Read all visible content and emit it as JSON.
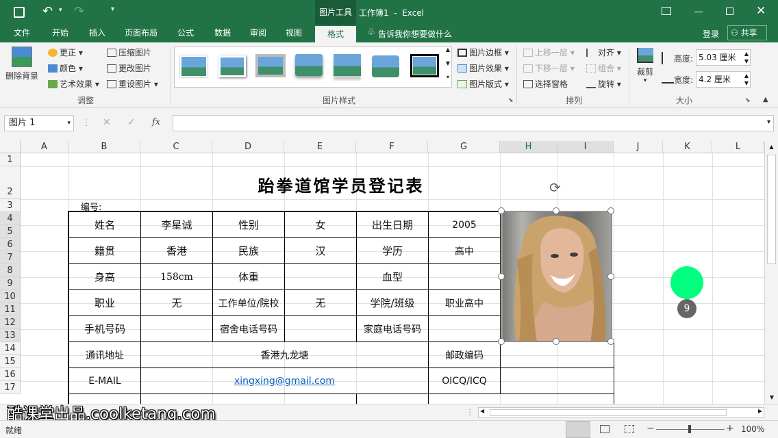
{
  "titlebar": {
    "tool_label": "图片工具",
    "doc_title": "工作簿1  -  Excel"
  },
  "tabs": [
    "文件",
    "开始",
    "插入",
    "页面布局",
    "公式",
    "数据",
    "审阅",
    "视图",
    "格式"
  ],
  "tell_me": "告诉我你想要做什么",
  "account": {
    "login": "登录",
    "share": "共享"
  },
  "ribbon": {
    "remove_bg": "删除背景",
    "adjust": [
      "更正",
      "颜色",
      "艺术效果"
    ],
    "adjust2": [
      "压缩图片",
      "更改图片",
      "重设图片"
    ],
    "adjust_group": "调整",
    "styles_group": "图片样式",
    "style_opts": [
      "图片边框",
      "图片效果",
      "图片版式"
    ],
    "arrange": [
      "上移一层",
      "下移一层",
      "选择窗格"
    ],
    "arrange2": [
      "对齐",
      "组合",
      "旋转"
    ],
    "arrange_group": "排列",
    "crop": "裁剪",
    "height_label": "高度:",
    "height_value": "5.03 厘米",
    "width_label": "宽度:",
    "width_value": "4.2 厘米",
    "size_group": "大小"
  },
  "formula": {
    "name_box": "图片 1",
    "fx": "fx",
    "content": ""
  },
  "columns": [
    "A",
    "B",
    "C",
    "D",
    "E",
    "F",
    "G",
    "H",
    "I",
    "J",
    "K",
    "L"
  ],
  "rows": [
    "1",
    "2",
    "3",
    "4",
    "5",
    "6",
    "7",
    "8",
    "9",
    "10",
    "11",
    "12",
    "13",
    "14",
    "15",
    "16",
    "17"
  ],
  "form": {
    "title": "跆拳道馆学员登记表",
    "number_label": "编号:",
    "r1": [
      "姓名",
      "李星诚",
      "性别",
      "女",
      "出生日期",
      "2005"
    ],
    "r2": [
      "籍贯",
      "香港",
      "民族",
      "汉",
      "学历",
      "高中"
    ],
    "r3": [
      "身高",
      "158cm",
      "体重",
      "",
      "血型",
      ""
    ],
    "r4": [
      "职业",
      "无",
      "工作单位/院校",
      "无",
      "学院/班级",
      "职业高中"
    ],
    "r5": [
      "手机号码",
      "",
      "宿舍电话号码",
      "",
      "家庭电话号码",
      ""
    ],
    "address_label": "通讯地址",
    "address": "香港九龙塘",
    "zip_label": "邮政编码",
    "email_label": "E-MAIL",
    "email": "xingxing@gmail.com",
    "qq_label": "OICQ/ICQ"
  },
  "marker_number": "9",
  "watermark": "酷课堂出品.coolketang.com",
  "status": {
    "ready": "就绪",
    "zoom": "100%"
  },
  "colors": {
    "excel_green": "#217346",
    "marker_green": "#00ff7f"
  }
}
